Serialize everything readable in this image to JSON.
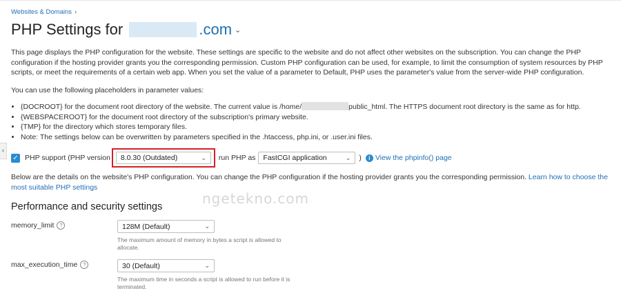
{
  "breadcrumb": {
    "label": "Websites & Domains"
  },
  "header": {
    "title_prefix": "PHP Settings for",
    "domain_suffix": ".com"
  },
  "intro": {
    "paragraph": "This page displays the PHP configuration for the website. These settings are specific to the website and do not affect other websites on the subscription. You can change the PHP configuration if the hosting provider grants you the corresponding permission. Custom PHP configuration can be used, for example, to limit the consumption of system resources by PHP scripts, or meet the requirements of a certain web app. When you set the value of a parameter to Default, PHP uses the parameter's value from the server-wide PHP configuration.",
    "placeholders_intro": "You can use the following placeholders in parameter values:"
  },
  "placeholders": {
    "docroot_start": "{DOCROOT} for the document root directory of the website. The current value is /home/",
    "docroot_end": "public_html. The HTTPS document root directory is the same as for http.",
    "webspaceroot": "{WEBSPACEROOT} for the document root directory of the subscription's primary website.",
    "tmp": "{TMP} for the directory which stores temporary files.",
    "note": "Note: The settings below can be overwritten by parameters specified in the .htaccess, php.ini, or .user.ini files."
  },
  "php_support": {
    "label": "PHP support (PHP version",
    "version": "8.0.30 (Outdated)",
    "run_as_label": "run PHP as",
    "handler": "FastCGI application",
    "close_paren": ")",
    "phpinfo_link": "View the phpinfo() page"
  },
  "details": {
    "text": "Below are the details on the website's PHP configuration. You can change the PHP configuration if the hosting provider grants you the corresponding permission.",
    "link": "Learn how to choose the most suitable PHP settings"
  },
  "watermark": "ngetekno.com",
  "section": {
    "title": "Performance and security settings"
  },
  "params": {
    "memory_limit": {
      "label": "memory_limit",
      "value": "128M (Default)",
      "description": "The maximum amount of memory in bytes a script is allowed to allocate."
    },
    "max_execution_time": {
      "label": "max_execution_time",
      "value": "30 (Default)",
      "description": "The maximum time in seconds a script is allowed to run before it is terminated."
    }
  },
  "icons": {
    "breadcrumb_chevron": "chevron-right-icon",
    "title_caret": "chevron-down-icon",
    "select_arrow": "chevron-down-icon",
    "checkbox": "checkmark-icon",
    "info": "info-icon",
    "help": "question-icon",
    "sidebar_toggle": "chevron-left-icon"
  },
  "colors": {
    "link": "#1f6fb2",
    "accent": "#2b8bd1",
    "highlight_border": "#d41f26"
  }
}
